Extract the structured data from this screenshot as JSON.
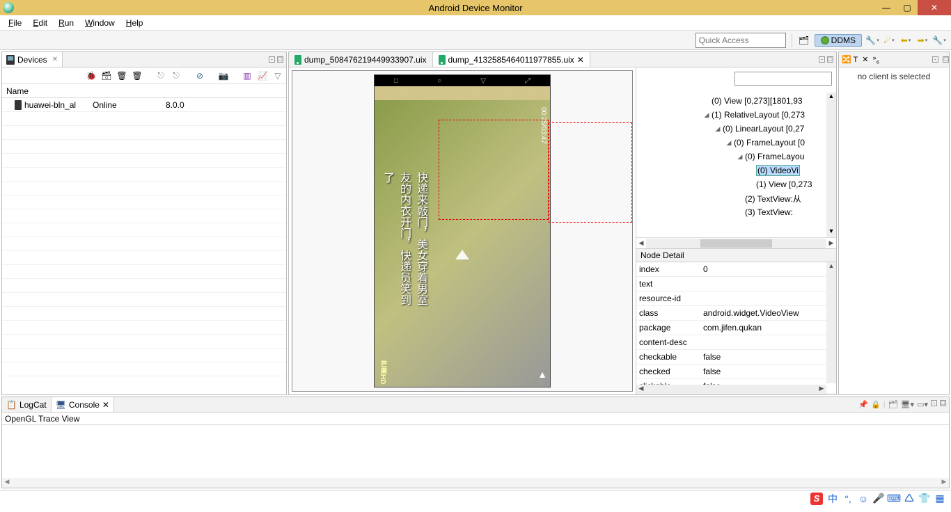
{
  "window": {
    "title": "Android Device Monitor"
  },
  "menubar": {
    "file": "File",
    "edit": "Edit",
    "run": "Run",
    "window": "Window",
    "help": "Help"
  },
  "toolbar": {
    "quick_access_placeholder": "Quick Access",
    "ddms_label": "DDMS"
  },
  "devices_pane": {
    "tab_label": "Devices",
    "header": "Name",
    "row": {
      "name": "huawei-bln_al",
      "status": "Online",
      "version": "8.0.0"
    }
  },
  "editor": {
    "tab1": "dump_5084762194499339​07.uix",
    "tab2": "dump_4132585464011977​855.uix"
  },
  "screencap": {
    "subtitle": "快递来敲门，美女穿着男室友的内衣开门，快递员笑到了",
    "time": "00:25/03:47",
    "hd": "芒果HD"
  },
  "tree": {
    "n0": "(0) View [0,273][1801,93",
    "n1": "(1) RelativeLayout [0,273",
    "n2": "(0) LinearLayout [0,27",
    "n3": "(0) FrameLayout [0",
    "n4": "(0) FrameLayou",
    "n5": "(0) VideoVi",
    "n6": "(1) View [0,273",
    "n7": "(2) TextView:从",
    "n8": "(3) TextView:"
  },
  "detail": {
    "header": "Node Detail",
    "rows": {
      "index_k": "index",
      "index_v": "0",
      "text_k": "text",
      "text_v": "",
      "resid_k": "resource-id",
      "resid_v": "",
      "class_k": "class",
      "class_v": "android.widget.VideoView",
      "package_k": "package",
      "package_v": "com.jifen.qukan",
      "cdesc_k": "content-desc",
      "cdesc_v": "",
      "checkable_k": "checkable",
      "checkable_v": "false",
      "checked_k": "checked",
      "checked_v": "false",
      "clickable_k": "clickable",
      "clickable_v": "false"
    }
  },
  "right_pane": {
    "message": "no client is selected"
  },
  "bottom_pane": {
    "logcat_tab": "LogCat",
    "console_tab": "Console",
    "trace_label": "OpenGL Trace View"
  },
  "taskbar": {
    "ime": "中"
  }
}
